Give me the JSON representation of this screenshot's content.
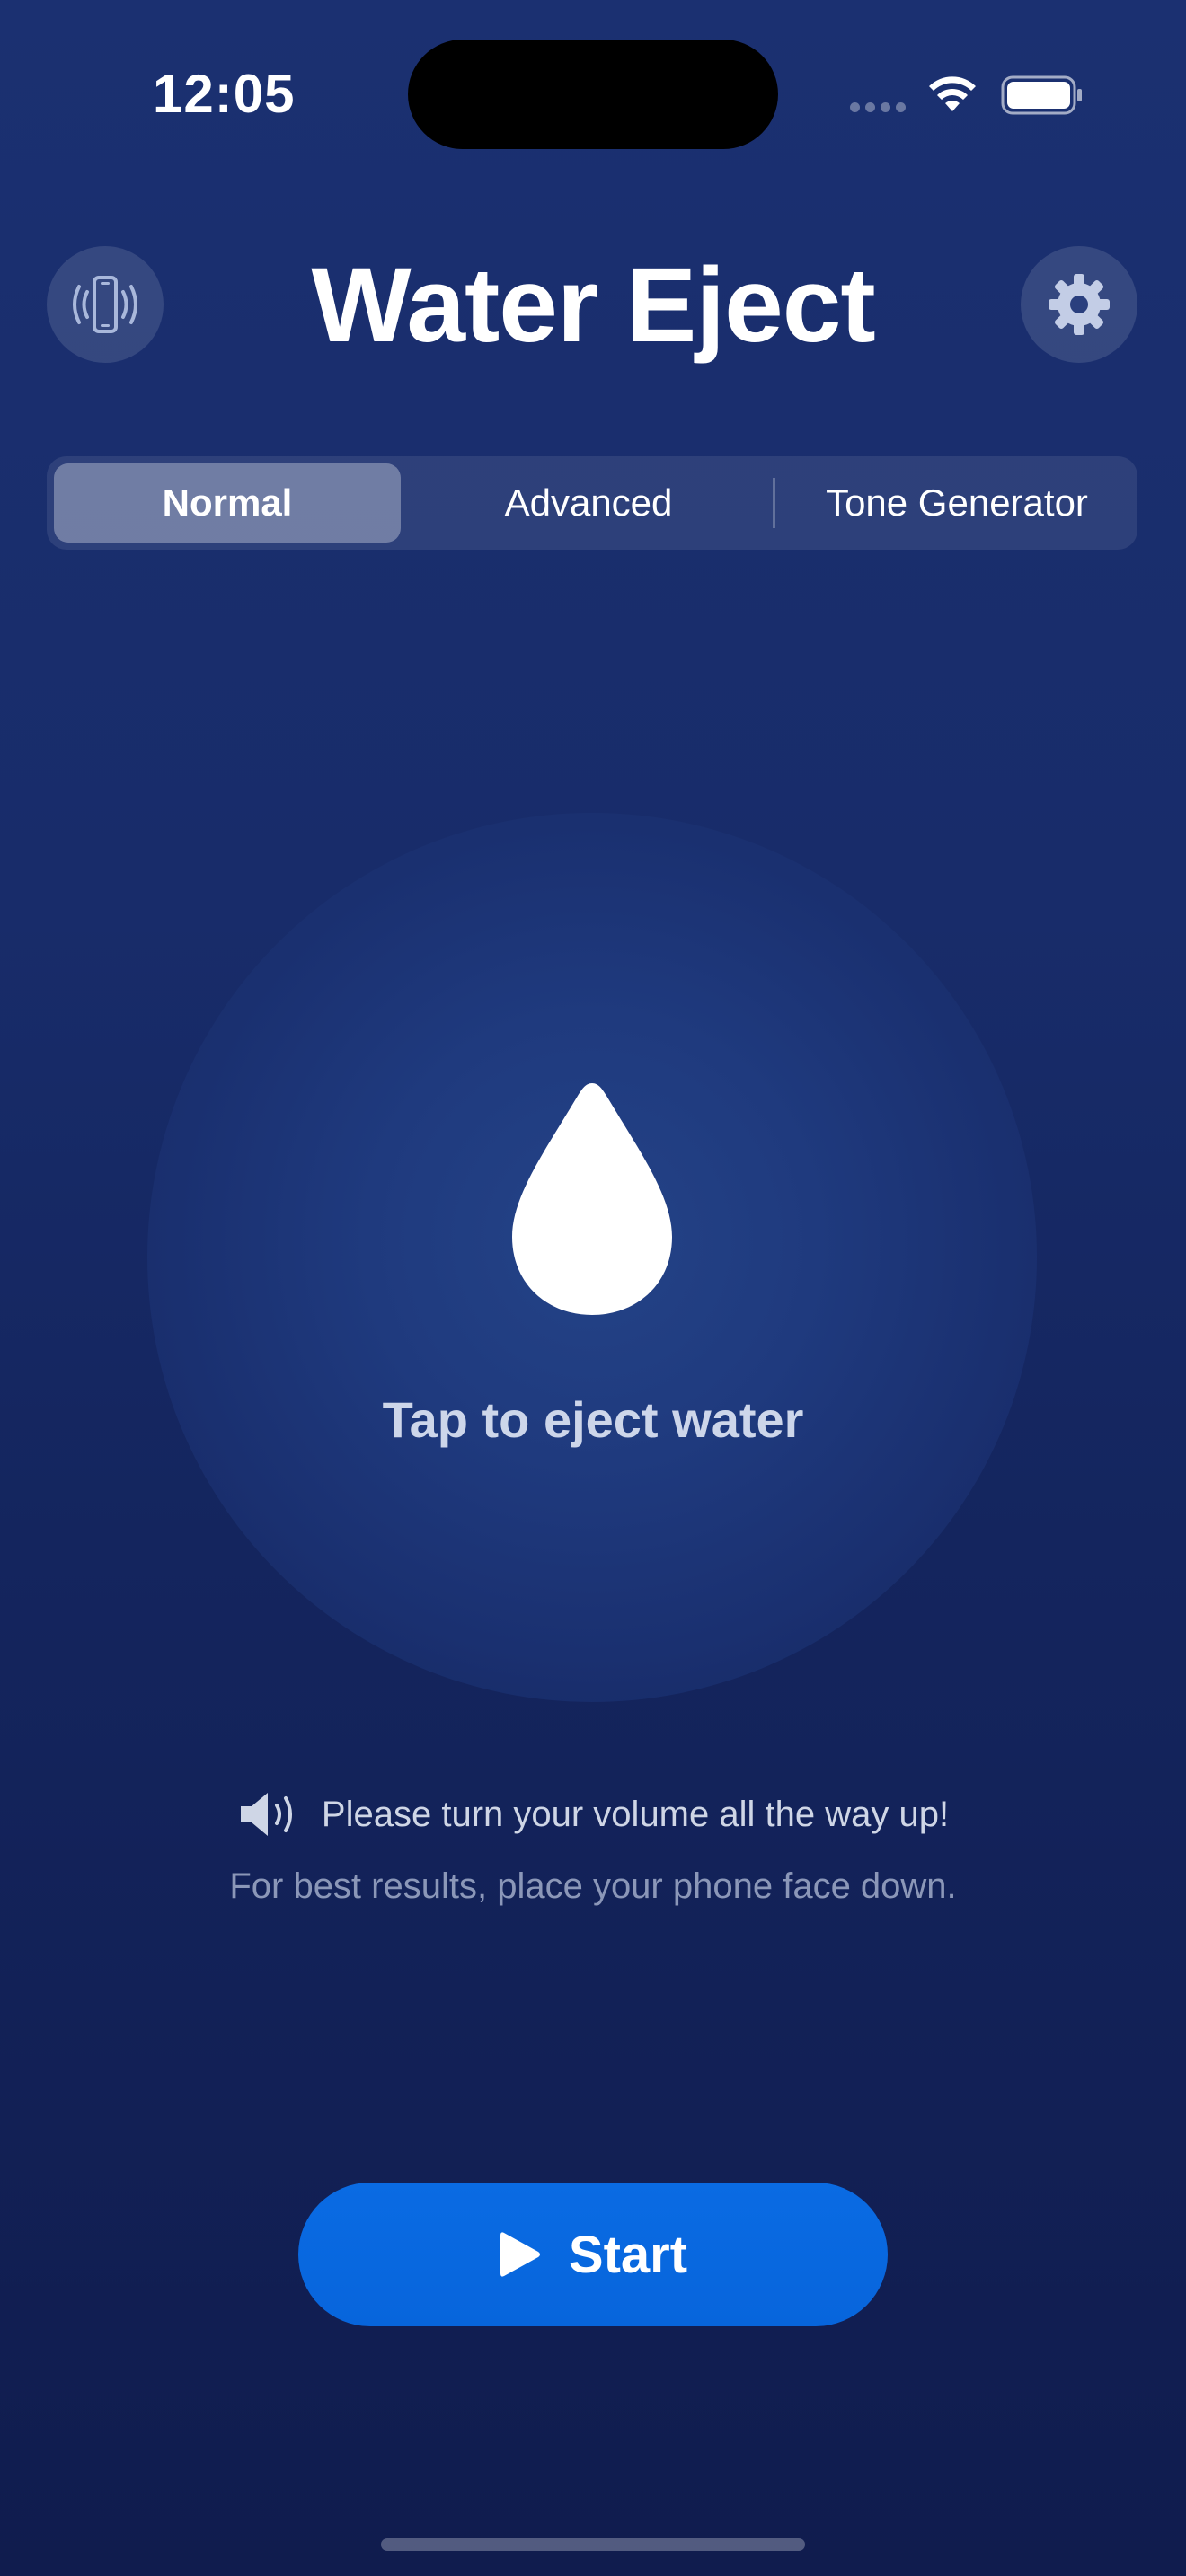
{
  "status_bar": {
    "time": "12:05"
  },
  "header": {
    "title": "Water Eject",
    "vibrate_icon": "phone-vibrate-icon",
    "settings_icon": "gear-icon"
  },
  "tabs": [
    {
      "label": "Normal",
      "selected": true
    },
    {
      "label": "Advanced",
      "selected": false
    },
    {
      "label": "Tone Generator",
      "selected": false
    }
  ],
  "main": {
    "drop_icon": "water-drop-icon",
    "prompt": "Tap to eject water"
  },
  "hints": {
    "volume": "Please turn your volume all the way up!",
    "placement": "For best results, place your phone face down."
  },
  "start_button": {
    "label": "Start",
    "icon": "play-icon"
  },
  "colors": {
    "background_top": "#1b3071",
    "background_bottom": "#101c4e",
    "accent": "#0765dc"
  }
}
